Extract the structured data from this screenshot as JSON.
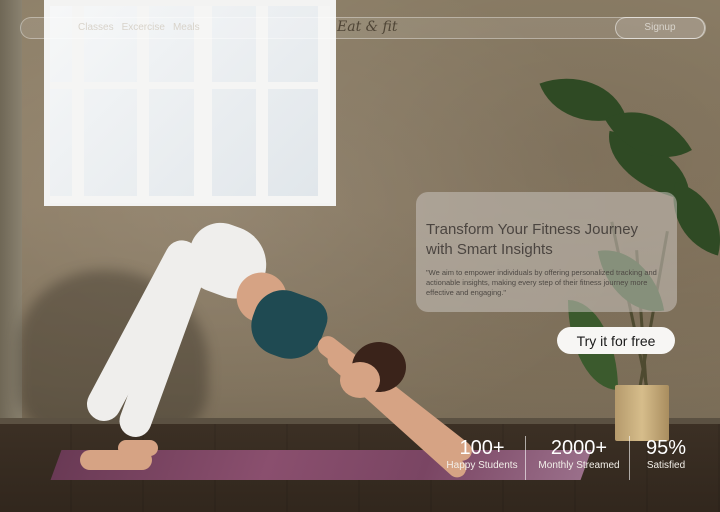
{
  "header": {
    "nav": [
      "Classes",
      "Excercise",
      "Meals"
    ],
    "brand": "Eat & fit",
    "signup_label": "Signup"
  },
  "hero": {
    "title_line1": "Transform Your Fitness Journey",
    "title_line2": "with Smart Insights",
    "body": "\"We aim to empower individuals by offering personalized tracking and actionable insights, making every step of their fitness journey more effective and engaging.\""
  },
  "cta_label": "Try it for free",
  "stats": [
    {
      "value": "100+",
      "label": "Happy Students"
    },
    {
      "value": "2000+",
      "label": "Monthly Streamed"
    },
    {
      "value": "95%",
      "label": "Satisfied"
    }
  ]
}
